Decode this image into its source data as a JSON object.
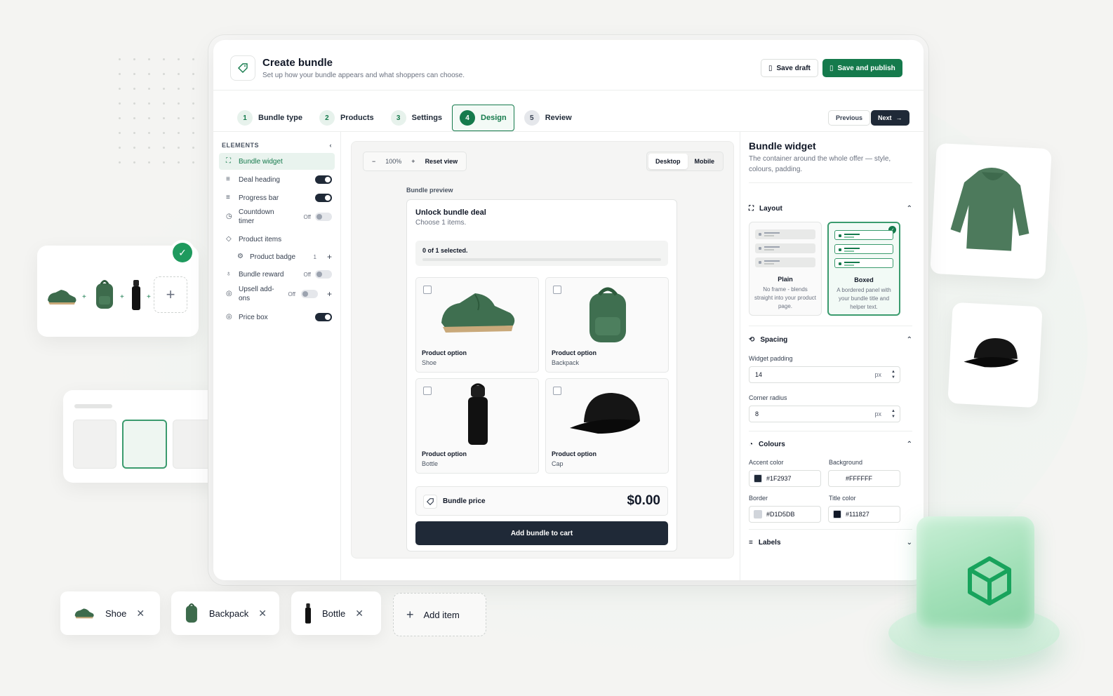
{
  "header": {
    "title": "Create bundle",
    "subtitle": "Set up how your bundle appears and what shoppers can choose.",
    "save_draft": "Save draft",
    "save_publish": "Save and publish"
  },
  "steps": [
    {
      "num": "1",
      "label": "Bundle type"
    },
    {
      "num": "2",
      "label": "Products"
    },
    {
      "num": "3",
      "label": "Settings"
    },
    {
      "num": "4",
      "label": "Design"
    },
    {
      "num": "5",
      "label": "Review"
    }
  ],
  "nav": {
    "previous": "Previous",
    "next": "Next"
  },
  "sidebar": {
    "heading": "ELEMENTS",
    "items": [
      {
        "label": "Bundle widget"
      },
      {
        "label": "Deal heading"
      },
      {
        "label": "Progress bar"
      },
      {
        "label": "Countdown timer",
        "state": "Off"
      },
      {
        "label": "Product items"
      },
      {
        "label": "Product badge",
        "count": "1"
      },
      {
        "label": "Bundle reward",
        "state": "Off"
      },
      {
        "label": "Upsell add-ons",
        "state": "Off"
      },
      {
        "label": "Price box"
      }
    ]
  },
  "canvas": {
    "zoom": "100%",
    "reset": "Reset view",
    "desktop": "Desktop",
    "mobile": "Mobile",
    "preview_label": "Bundle preview"
  },
  "widget": {
    "title": "Unlock bundle deal",
    "subtitle": "Choose 1 items.",
    "progress_text": "0 of 1 selected.",
    "progress_fraction": 0,
    "products": [
      {
        "name": "Product option",
        "value": "Shoe"
      },
      {
        "name": "Product option",
        "value": "Backpack"
      },
      {
        "name": "Product option",
        "value": "Bottle"
      },
      {
        "name": "Product option",
        "value": "Cap"
      }
    ],
    "price_label": "Bundle price",
    "price_value": "$0.00",
    "cart_button": "Add bundle to cart"
  },
  "panel": {
    "title": "Bundle widget",
    "subtitle": "The container around the whole offer — style, colours, padding.",
    "layout_heading": "Layout",
    "layout_options": [
      {
        "name": "Plain",
        "desc": "No frame - blends straight into your product page."
      },
      {
        "name": "Boxed",
        "desc": "A bordered panel with your bundle title and helper text."
      }
    ],
    "spacing_heading": "Spacing",
    "padding_label": "Widget padding",
    "padding_value": "14",
    "radius_label": "Corner radius",
    "radius_value": "8",
    "unit": "px",
    "colours_heading": "Colours",
    "accent_label": "Accent color",
    "accent_value": "#1F2937",
    "background_label": "Background",
    "background_value": "#FFFFFF",
    "border_label": "Border",
    "border_value": "#D1D5DB",
    "title_color_label": "Title color",
    "title_color_value": "#111827",
    "labels_heading": "Labels"
  },
  "chips": [
    {
      "label": "Shoe"
    },
    {
      "label": "Backpack"
    },
    {
      "label": "Bottle"
    }
  ],
  "add_item": "Add item",
  "colors": {
    "brand": "#157A4C",
    "dark": "#1F2937"
  }
}
